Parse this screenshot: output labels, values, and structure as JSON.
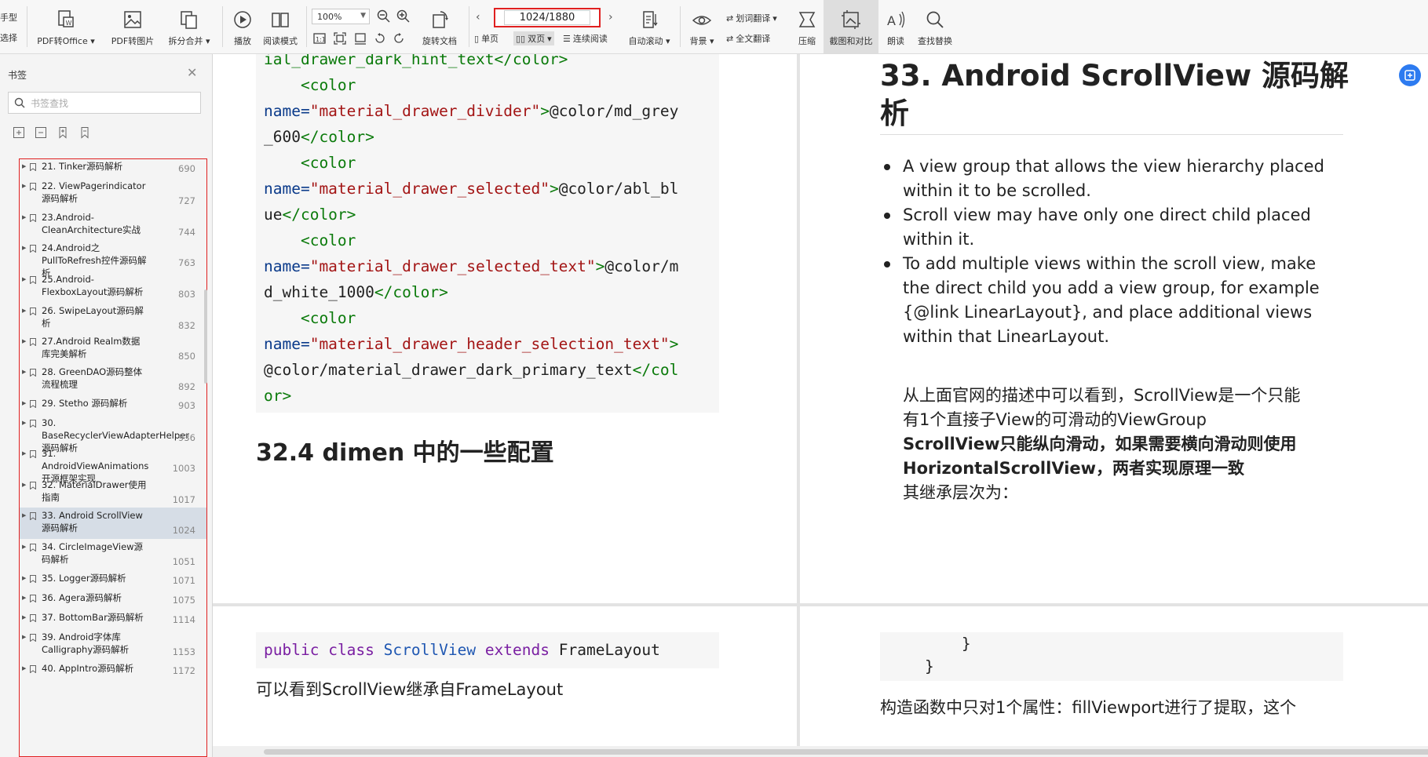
{
  "toolbar": {
    "left_partial_top": "手型",
    "left_partial_bottom": "选择",
    "pdf_to_office": "PDF转Office",
    "pdf_to_image": "PDF转图片",
    "split_merge": "拆分合并",
    "play": "播放",
    "read_mode": "阅读模式",
    "zoom_value": "100%",
    "rotate_doc": "旋转文档",
    "page_value": "1024/1880",
    "single_page": "单页",
    "double_page": "双页",
    "continuous_read": "连续阅读",
    "auto_scroll": "自动滚动",
    "background": "背景",
    "word_translate": "划词翻译",
    "full_translate": "全文翻译",
    "compress": "压缩",
    "screenshot_compare": "截图和对比",
    "read_aloud": "朗读",
    "find_replace": "查找替换"
  },
  "sidebar": {
    "title": "书签",
    "search_placeholder": "书签查找",
    "bookmarks": [
      {
        "title": "21. Tinker源码解析",
        "page": "690"
      },
      {
        "title": "22. ViewPagerindicator源码解析",
        "page": "727"
      },
      {
        "title": "23.Android-CleanArchitecture实战",
        "page": "744"
      },
      {
        "title": "24.Android之PullToRefresh控件源码解析",
        "page": "763"
      },
      {
        "title": "25.Android-FlexboxLayout源码解析",
        "page": "803"
      },
      {
        "title": "26. SwipeLayout源码解析",
        "page": "832"
      },
      {
        "title": "27.Android Realm数据库完美解析",
        "page": "850"
      },
      {
        "title": "28. GreenDAO源码整体流程梳理",
        "page": "892"
      },
      {
        "title": "29. Stetho 源码解析",
        "page": "903"
      },
      {
        "title": "30. BaseRecyclerViewAdapterHelper源码解析",
        "page": "936"
      },
      {
        "title": "31. AndroidViewAnimations开源框架实现",
        "page": "1003"
      },
      {
        "title": "32. MaterialDrawer使用指南",
        "page": "1017"
      },
      {
        "title": "33. Android ScrollView源码解析",
        "page": "1024"
      },
      {
        "title": "34. CircleImageView源码解析",
        "page": "1051"
      },
      {
        "title": "35. Logger源码解析",
        "page": "1071"
      },
      {
        "title": "36. Agera源码解析",
        "page": "1075"
      },
      {
        "title": "37. BottomBar源码解析",
        "page": "1114"
      },
      {
        "title": "39. Android字体库Calligraphy源码解析",
        "page": "1153"
      },
      {
        "title": "40. AppIntro源码解析",
        "page": "1172"
      }
    ]
  },
  "left_page_top": {
    "code_lines": [
      [
        [
          "tag",
          "ial_drawer_dark_hint_text</color>"
        ]
      ],
      [
        [
          "tag",
          "    <color"
        ]
      ],
      [
        [
          "attr",
          "name="
        ],
        [
          "str",
          "\"material_drawer_divider\""
        ],
        [
          "tag",
          ">"
        ],
        [
          "plain",
          "@color/md_grey"
        ]
      ],
      [
        [
          "plain",
          "_600"
        ],
        [
          "tag",
          "</color>"
        ]
      ],
      [
        [
          "tag",
          "    <color"
        ]
      ],
      [
        [
          "attr",
          "name="
        ],
        [
          "str",
          "\"material_drawer_selected\""
        ],
        [
          "tag",
          ">"
        ],
        [
          "plain",
          "@color/abl_bl"
        ]
      ],
      [
        [
          "plain",
          "ue"
        ],
        [
          "tag",
          "</color>"
        ]
      ],
      [
        [
          "tag",
          "    <color"
        ]
      ],
      [
        [
          "attr",
          "name="
        ],
        [
          "str",
          "\"material_drawer_selected_text\""
        ],
        [
          "tag",
          ">"
        ],
        [
          "plain",
          "@color/m"
        ]
      ],
      [
        [
          "plain",
          "d_white_1000"
        ],
        [
          "tag",
          "</color>"
        ]
      ],
      [
        [
          "tag",
          "    <color"
        ]
      ],
      [
        [
          "attr",
          "name="
        ],
        [
          "str",
          "\"material_drawer_header_selection_text\""
        ],
        [
          "tag",
          ">"
        ]
      ],
      [
        [
          "plain",
          "@color/material_drawer_dark_primary_text"
        ],
        [
          "tag",
          "</col"
        ]
      ],
      [
        [
          "tag",
          "or>"
        ]
      ]
    ],
    "heading": "32.4 dimen 中的一些配置"
  },
  "right_page_top": {
    "heading_line1": "33. Android ScrollView 源码解",
    "heading_line2": "析",
    "bullets": [
      [
        "A view group that allows the view hierarchy placed",
        "within it to be scrolled."
      ],
      [
        "Scroll view may have only one direct child placed",
        "within it."
      ],
      [
        "To add multiple views within the scroll view, make",
        "the direct child you add a view group, for example",
        "{@link LinearLayout}, and place additional views",
        "within that LinearLayout."
      ]
    ],
    "para1_line1": "从上面官网的描述中可以看到，ScrollView是一个只能",
    "para1_line2": "有1个直接子View的可滑动的ViewGroup",
    "bold_line1": "ScrollView只能纵向滑动，如果需要横向滑动则使用",
    "bold_line2": "HorizontalScrollView，两者实现原理一致",
    "para2": "其继承层次为："
  },
  "left_page_bottom": {
    "code_kw1": "public",
    "code_kw2": "class",
    "code_cls": "ScrollView",
    "code_kw3": "extends",
    "code_plain": "FrameLayout",
    "text": "可以看到ScrollView继承自FrameLayout"
  },
  "right_page_bottom": {
    "brace1": "        }",
    "brace2": "    }",
    "text": "构造函数中只对1个属性：fillViewport进行了提取，这个"
  }
}
